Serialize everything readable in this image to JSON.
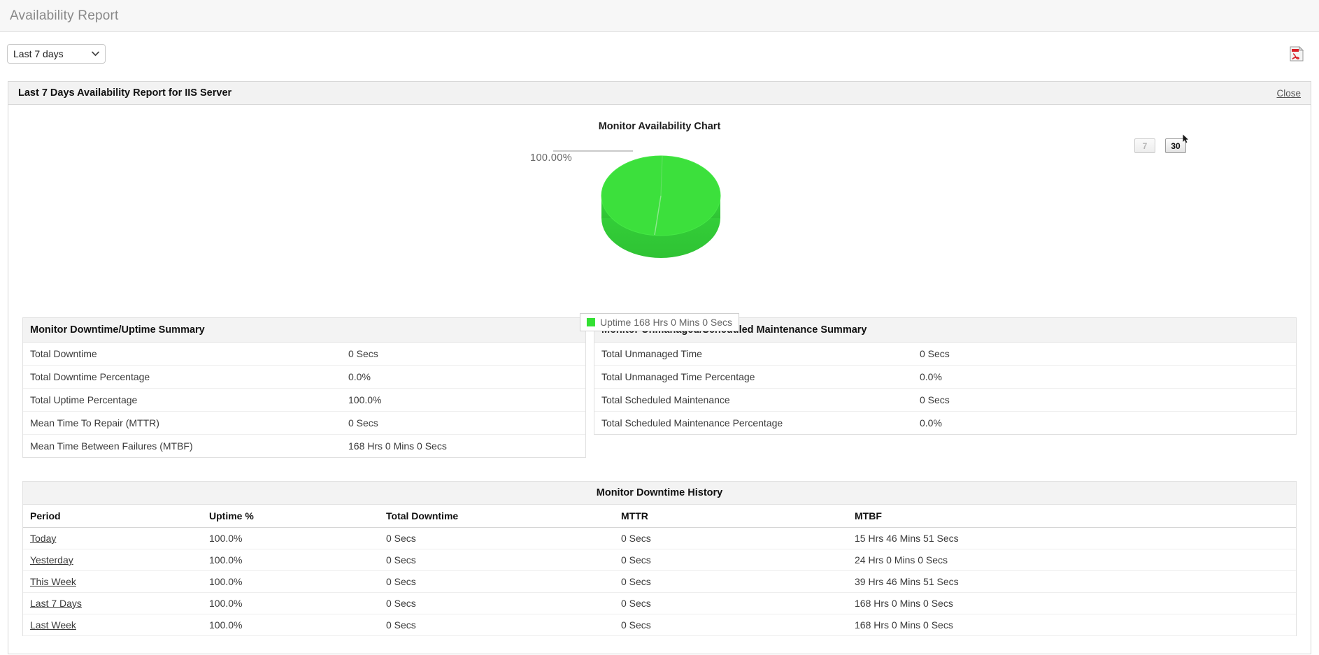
{
  "header": {
    "title": "Availability Report"
  },
  "toolbar": {
    "period_value": "Last 7 days",
    "period_options": [
      "Last 7 days"
    ],
    "export_icon": "pdf-icon"
  },
  "panel": {
    "title": "Last 7 Days Availability Report for IIS Server",
    "close_label": "Close"
  },
  "chart": {
    "title": "Monitor Availability Chart",
    "range_buttons": [
      {
        "label": "7",
        "active": false
      },
      {
        "label": "30",
        "active": true
      }
    ],
    "slice_label": "100.00%",
    "legend_label": "Uptime 168 Hrs 0 Mins 0 Secs"
  },
  "chart_data": {
    "type": "pie",
    "title": "Monitor Availability Chart",
    "categories": [
      "Uptime"
    ],
    "values": [
      100.0
    ],
    "value_labels": [
      "100.00%"
    ],
    "legend": [
      "Uptime 168 Hrs 0 Mins 0 Secs"
    ],
    "legend_position": "bottom",
    "colors": [
      "#33e033"
    ],
    "grid": false
  },
  "downtime_summary": {
    "title": "Monitor Downtime/Uptime Summary",
    "rows": [
      {
        "key": "Total Downtime",
        "value": "0 Secs"
      },
      {
        "key": "Total Downtime Percentage",
        "value": "0.0%"
      },
      {
        "key": "Total Uptime Percentage",
        "value": "100.0%"
      },
      {
        "key": "Mean Time To Repair (MTTR)",
        "value": "0 Secs"
      },
      {
        "key": "Mean Time Between Failures (MTBF)",
        "value": "168 Hrs 0 Mins 0 Secs"
      }
    ]
  },
  "maintenance_summary": {
    "title": "Monitor Unmanaged/Scheduled Maintenance Summary",
    "rows": [
      {
        "key": "Total Unmanaged Time",
        "value": "0 Secs"
      },
      {
        "key": "Total Unmanaged Time Percentage",
        "value": "0.0%"
      },
      {
        "key": "Total Scheduled Maintenance",
        "value": "0 Secs"
      },
      {
        "key": "Total Scheduled Maintenance Percentage",
        "value": "0.0%"
      }
    ]
  },
  "history": {
    "title": "Monitor Downtime History",
    "columns": [
      "Period",
      "Uptime %",
      "Total Downtime",
      "MTTR",
      "MTBF"
    ],
    "rows": [
      {
        "period": "Today",
        "uptime": "100.0%",
        "downtime": "0 Secs",
        "mttr": "0 Secs",
        "mtbf": "15 Hrs 46 Mins 51 Secs"
      },
      {
        "period": "Yesterday",
        "uptime": "100.0%",
        "downtime": "0 Secs",
        "mttr": "0 Secs",
        "mtbf": "24 Hrs 0 Mins 0 Secs"
      },
      {
        "period": "This Week",
        "uptime": "100.0%",
        "downtime": "0 Secs",
        "mttr": "0 Secs",
        "mtbf": "39 Hrs 46 Mins 51 Secs"
      },
      {
        "period": "Last 7 Days",
        "uptime": "100.0%",
        "downtime": "0 Secs",
        "mttr": "0 Secs",
        "mtbf": "168 Hrs 0 Mins 0 Secs"
      },
      {
        "period": "Last Week",
        "uptime": "100.0%",
        "downtime": "0 Secs",
        "mttr": "0 Secs",
        "mtbf": "168 Hrs 0 Mins 0 Secs"
      }
    ]
  },
  "colors": {
    "accent_green": "#33e033",
    "panel_head": "#f2f2f2",
    "header_text": "#888888"
  }
}
